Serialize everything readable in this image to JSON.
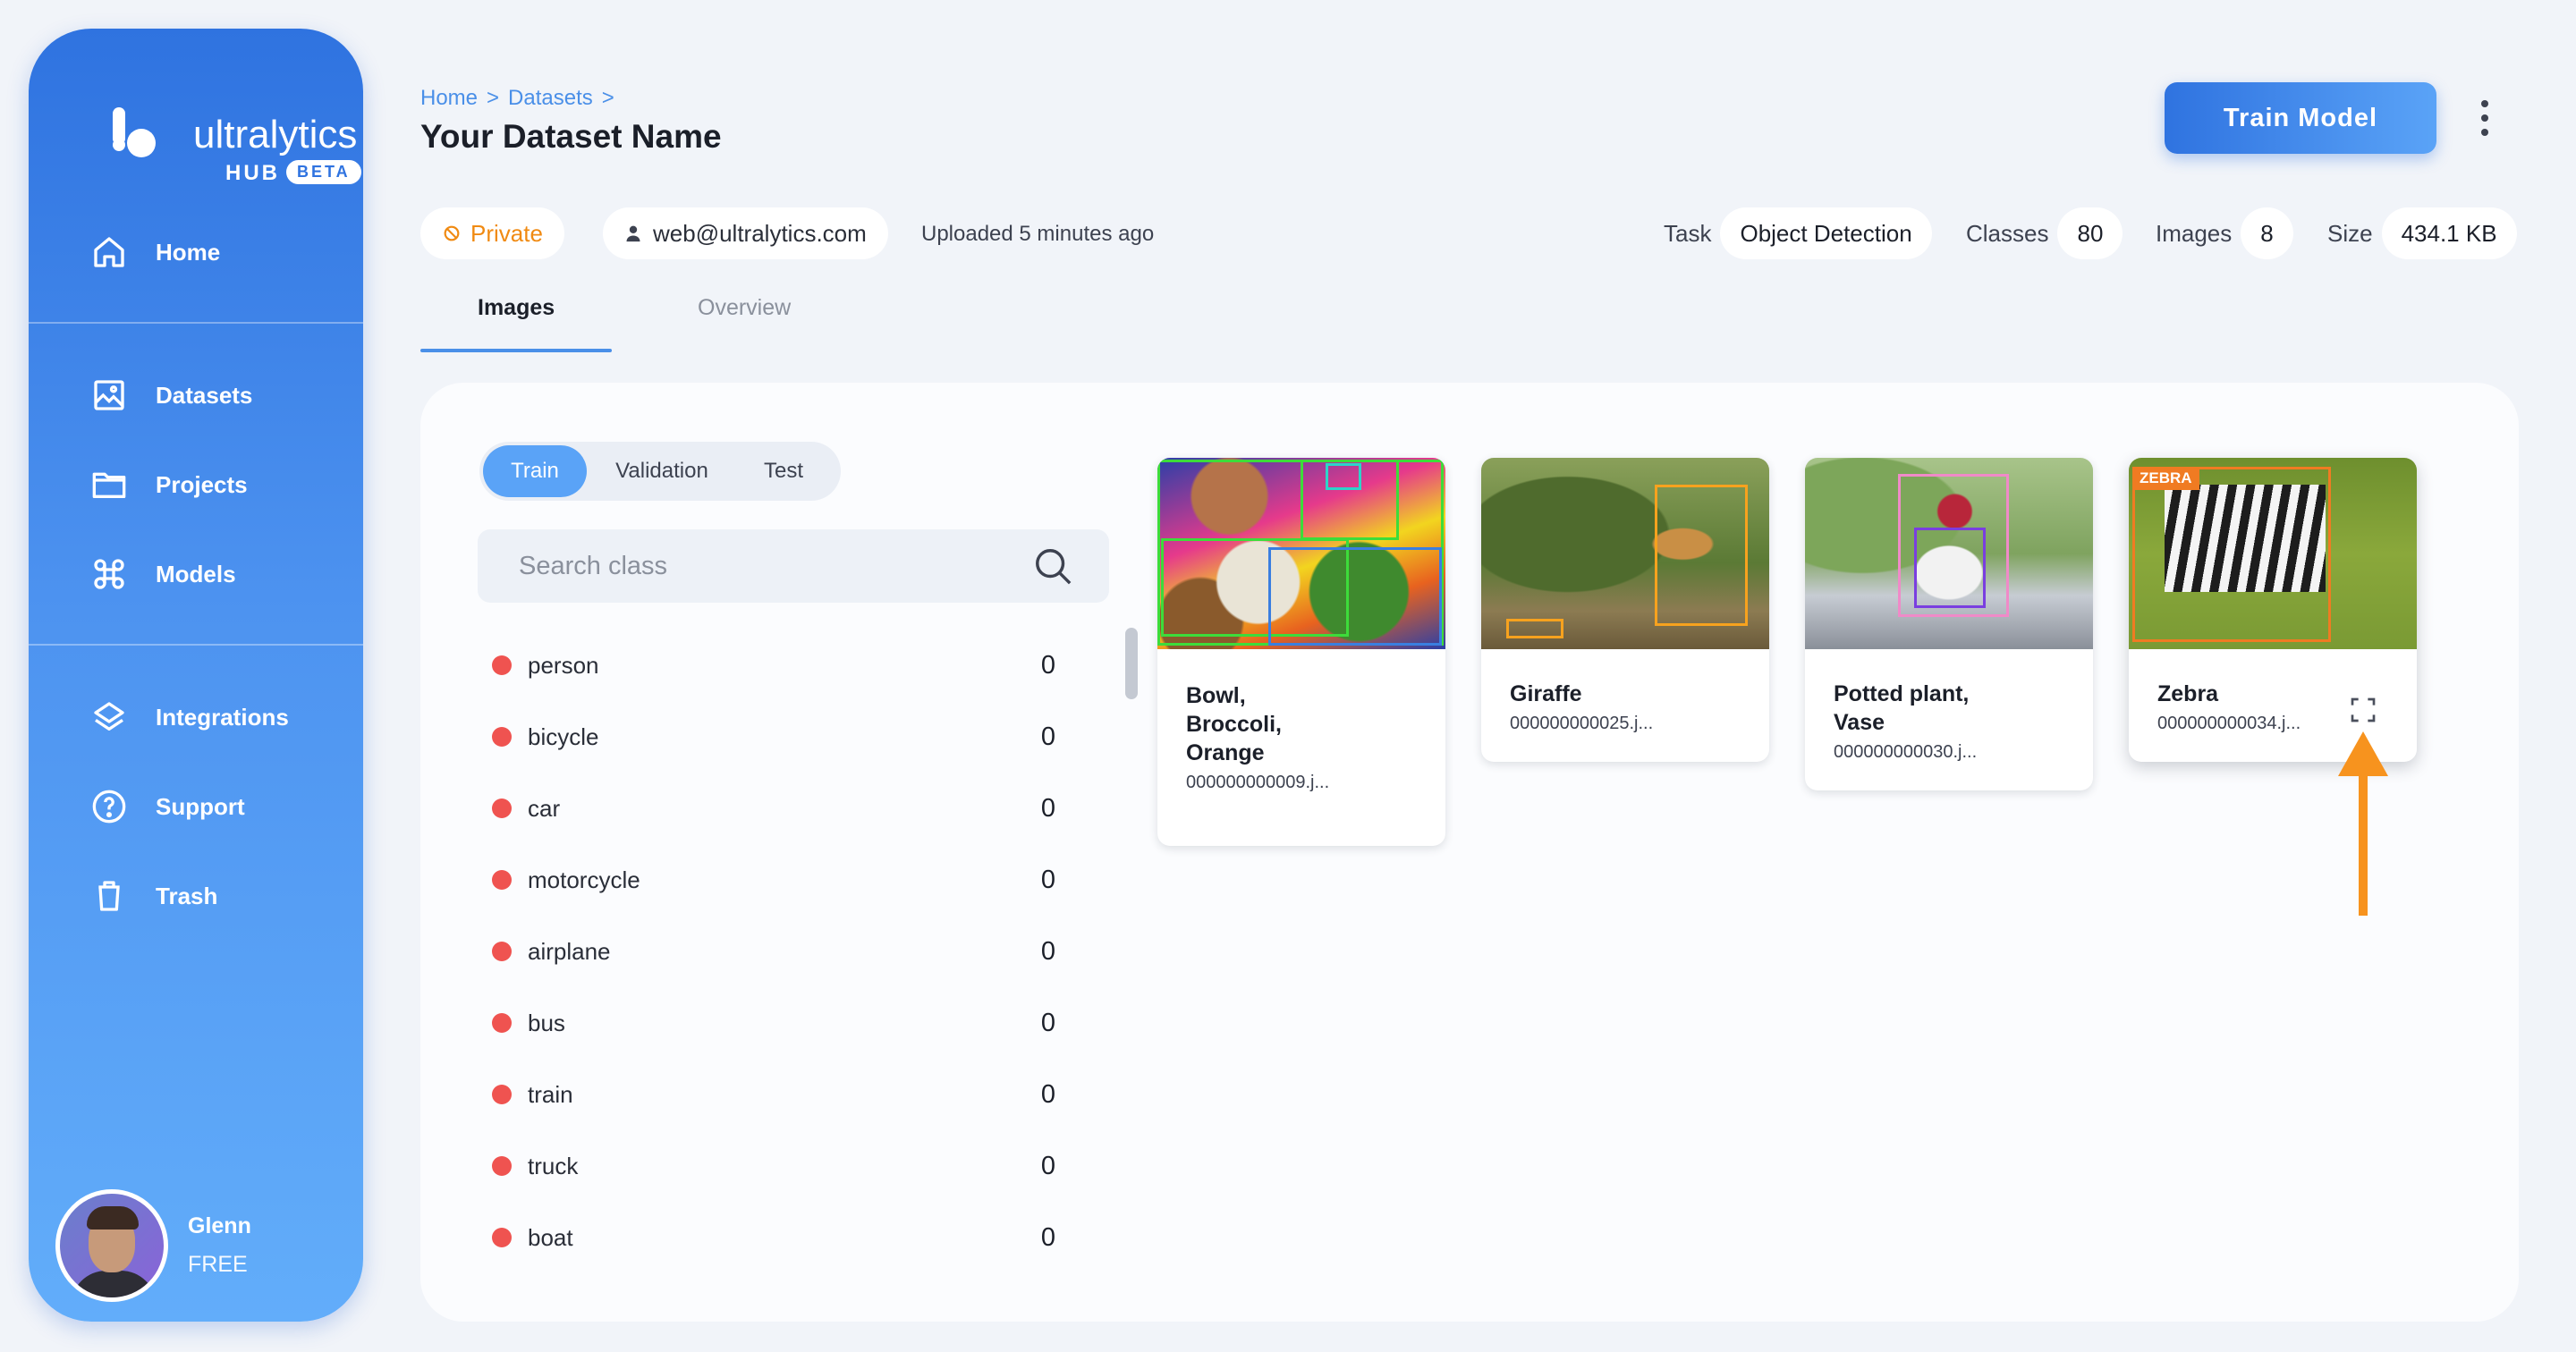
{
  "brand": {
    "name": "ultralytics",
    "hub": "HUB",
    "badge": "BETA"
  },
  "sidebar": {
    "items": [
      {
        "label": "Home",
        "icon": "home-icon"
      },
      {
        "label": "Datasets",
        "icon": "image-icon"
      },
      {
        "label": "Projects",
        "icon": "folder-icon"
      },
      {
        "label": "Models",
        "icon": "command-icon"
      },
      {
        "label": "Integrations",
        "icon": "layers-icon"
      },
      {
        "label": "Support",
        "icon": "help-circle-icon"
      },
      {
        "label": "Trash",
        "icon": "trash-icon"
      }
    ],
    "user": {
      "name": "Glenn",
      "plan": "FREE"
    }
  },
  "header": {
    "breadcrumb": [
      "Home",
      ">",
      "Datasets",
      ">"
    ],
    "title": "Your Dataset Name",
    "train_button": "Train Model"
  },
  "meta": {
    "visibility": "Private",
    "owner": "web@ultralytics.com",
    "uploaded": "Uploaded 5 minutes ago",
    "task_label": "Task",
    "task_value": "Object Detection",
    "classes_label": "Classes",
    "classes_value": "80",
    "images_label": "Images",
    "images_value": "8",
    "size_label": "Size",
    "size_value": "434.1 KB"
  },
  "tabs": {
    "images": "Images",
    "overview": "Overview"
  },
  "split": {
    "train": "Train",
    "validation": "Validation",
    "test": "Test"
  },
  "search": {
    "placeholder": "Search class"
  },
  "classes": [
    {
      "name": "person",
      "count": "0"
    },
    {
      "name": "bicycle",
      "count": "0"
    },
    {
      "name": "car",
      "count": "0"
    },
    {
      "name": "motorcycle",
      "count": "0"
    },
    {
      "name": "airplane",
      "count": "0"
    },
    {
      "name": "bus",
      "count": "0"
    },
    {
      "name": "train",
      "count": "0"
    },
    {
      "name": "truck",
      "count": "0"
    },
    {
      "name": "boat",
      "count": "0"
    }
  ],
  "cards": [
    {
      "title_lines": [
        "Bowl,",
        "Broccoli,",
        "Orange"
      ],
      "file": "000000000009.j..."
    },
    {
      "title_lines": [
        "Giraffe"
      ],
      "file": "000000000025.j..."
    },
    {
      "title_lines": [
        "Potted plant,",
        "Vase"
      ],
      "file": "000000000030.j..."
    },
    {
      "title_lines": [
        "Zebra"
      ],
      "file": "000000000034.j...",
      "tag": "ZEBRA"
    }
  ],
  "colors": {
    "accent": "#4a8fe8",
    "private": "#f08a12",
    "class_dot": "#ef5350",
    "arrow": "#f7931e"
  }
}
